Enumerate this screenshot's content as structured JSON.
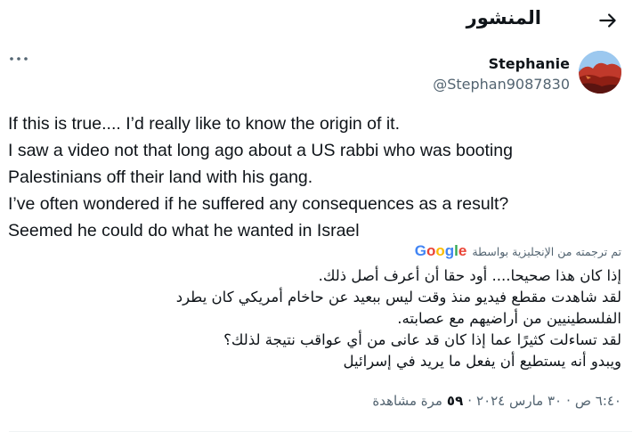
{
  "header": {
    "title": "المنشور",
    "back_icon": "arrow-right-icon"
  },
  "author": {
    "name": "Stephanie",
    "handle": "@Stephan9087830",
    "avatar_icon": "landscape-avatar"
  },
  "more_icon": "more-dots-icon",
  "tweet": {
    "lines": [
      "If this is true.... I’d really like to know the origin of it.",
      "I saw a video not that long ago about a US rabbi who was booting",
      "Palestinians off their land with his gang.",
      "I’ve often wondered if he suffered any consequences as a result?",
      "Seemed he could do what he wanted in Israel"
    ]
  },
  "translation": {
    "label": "تم ترجمته من الإنجليزية بواسطة",
    "provider": "Google",
    "lines": [
      "إذا كان هذا صحيحا.... أود حقا أن أعرف أصل ذلك.",
      "لقد شاهدت مقطع فيديو منذ وقت ليس ببعيد عن حاخام أمريكي كان يطرد",
      "الفلسطينيين من أراضيهم مع عصابته.",
      "لقد تساءلت كثيرًا عما إذا كان قد عانى من أي عواقب نتيجة لذلك؟",
      "ويبدو أنه يستطيع أن يفعل ما يريد في إسرائيل"
    ]
  },
  "meta": {
    "time": "٦:٤٠ ص",
    "separator": "·",
    "date": "٣٠ مارس ٢٠٢٤",
    "views_count": "٥٩",
    "views_label": "مرة مشاهدة"
  },
  "colors": {
    "text": "#0f1419",
    "secondary": "#536471",
    "divider": "#eff3f4"
  }
}
